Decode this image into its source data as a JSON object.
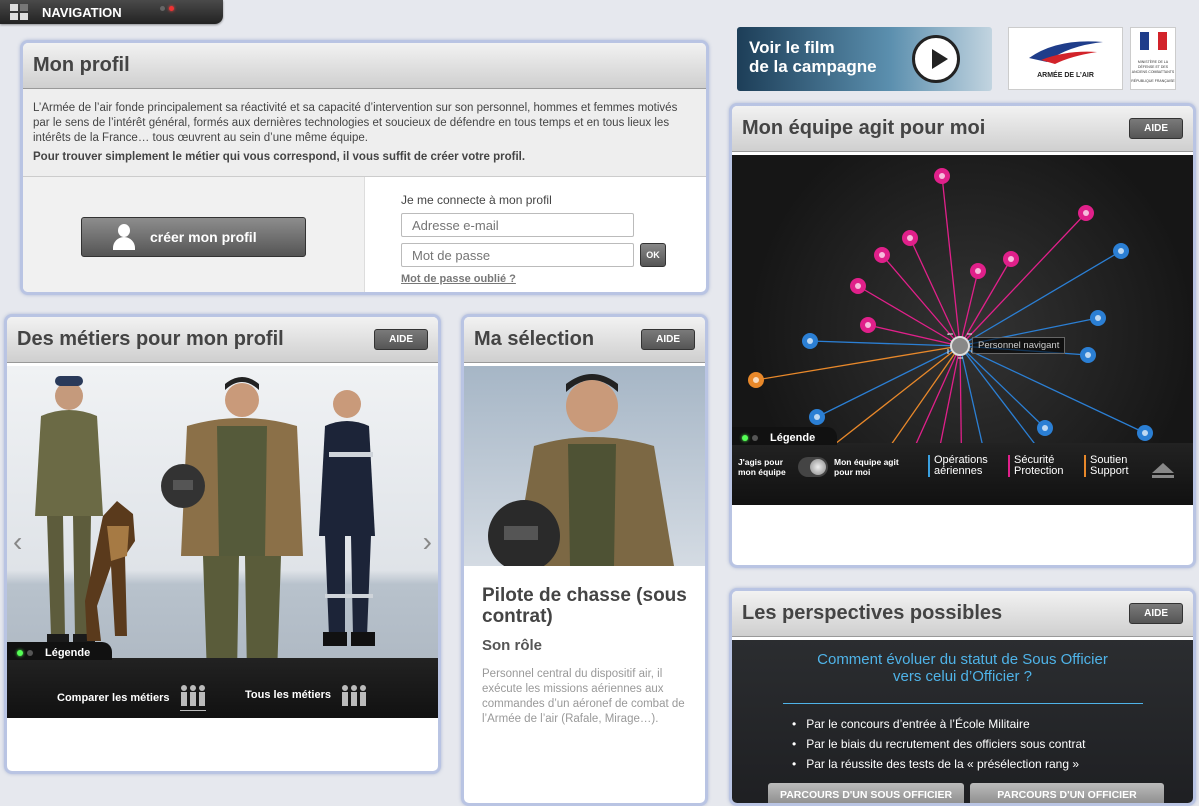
{
  "nav": {
    "label": "NAVIGATION"
  },
  "profil": {
    "title": "Mon profil",
    "intro": "L’Armée de l’air fonde principalement sa réactivité et sa capacité d’intervention sur son personnel, hommes et femmes motivés par le sens de l’intérêt général, formés aux dernières technologies et soucieux de défendre en tous temps et en tous lieux les intérêts de la France… tous œuvrent au sein d’une même équipe.",
    "intro_bold": "Pour trouver simplement le métier qui vous correspond, il vous suffit de créer votre profil.",
    "create_label": "créer mon profil",
    "login_label": "Je me connecte à mon profil",
    "email_placeholder": "Adresse e-mail",
    "password_placeholder": "Mot de passe",
    "ok_label": "OK",
    "forgot_label": "Mot de passe oublié ?"
  },
  "metiers": {
    "title": "Des métiers pour mon profil",
    "aide": "AIDE",
    "prev": "‹",
    "next": "›",
    "legend": "Légende",
    "compare": "Comparer les métiers",
    "all": "Tous les métiers"
  },
  "selection": {
    "title": "Ma sélection",
    "aide": "AIDE",
    "job_title": "Pilote de chasse (sous contrat)",
    "role_heading": "Son rôle",
    "description": "Personnel central du dispositif air, il exécute les missions aériennes aux commandes d’un aéronef de combat de l’Armée de l’air (Rafale, Mirage…)."
  },
  "video": {
    "line1": "Voir le film",
    "line2": "de la campagne"
  },
  "logos": {
    "armee": "ARMÉE DE L’AIR",
    "ministere": "MINISTÈRE DE LA DÉFENSE ET DES ANCIENS COMBATTANTS",
    "republique": "RÉPUBLIQUE FRANÇAISE"
  },
  "equipe": {
    "title": "Mon équipe agit pour moi",
    "aide": "AIDE",
    "center_label": "Personnel navigant",
    "legend": "Légende",
    "toggle_left": "J'agis pour mon équipe",
    "toggle_right": "Mon équipe agit pour moi",
    "cat1": "Opérations aériennes",
    "cat2": "Sécurité Protection",
    "cat3": "Soutien Support",
    "colors": {
      "pink": "#e0208a",
      "blue": "#2b7fd4",
      "orange": "#e8882a",
      "cat1": "#3aa0e0",
      "cat2": "#e0208a",
      "cat3": "#e8882a"
    }
  },
  "perspectives": {
    "title": "Les perspectives possibles",
    "aide": "AIDE",
    "question_l1": "Comment évoluer du statut de Sous Officier",
    "question_l2": "vers celui d’Officier ?",
    "items": [
      "Par le concours d’entrée à l’École Militaire",
      "Par le biais du recrutement des officiers sous contrat",
      "Par la réussite des tests de la « présélection rang »"
    ],
    "btn1": "PARCOURS D'UN SOUS OFFICIER",
    "btn2": "PARCOURS D'UN OFFICIER"
  }
}
